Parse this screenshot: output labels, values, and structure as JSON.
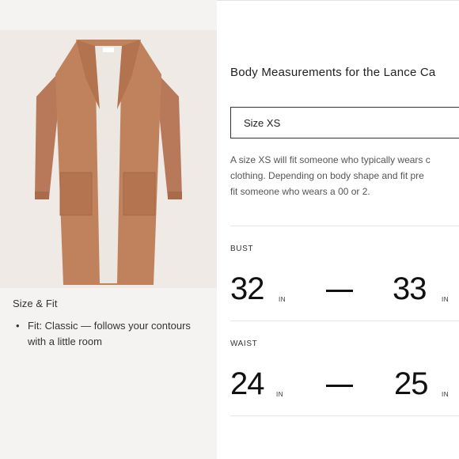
{
  "product_panel": {
    "image_alt": "camel long cardigan",
    "size_fit_title": "Size & Fit",
    "fit_items": [
      {
        "bullet": "•",
        "lines": [
          "Fit: Classic — follows your contours",
          "with a little room"
        ]
      }
    ]
  },
  "measurements_panel": {
    "title": "Body Measurements for the Lance Ca",
    "size_select": {
      "selected": "Size XS"
    },
    "description_lines": [
      "A size XS will fit someone who typically wears c",
      "clothing. Depending on body shape and fit pre",
      "fit someone who wears a 00 or 2."
    ],
    "measurements": [
      {
        "label": "BUST",
        "min": "32",
        "max": "33",
        "unit": "IN"
      },
      {
        "label": "WAIST",
        "min": "24",
        "max": "25",
        "unit": "IN"
      }
    ]
  },
  "colors": {
    "left_background": "#f4f3f2",
    "image_background": "#efeae6",
    "cardigan_camel": "#c0825d",
    "cardigan_lining": "#ece8e1",
    "text_dark": "#111111"
  },
  "icons": {
    "bullet": "bullet-icon"
  }
}
